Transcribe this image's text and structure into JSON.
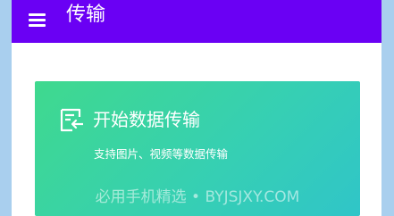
{
  "header": {
    "title": "传输",
    "menu_icon": "menu-icon",
    "color": "#6a00f4"
  },
  "card": {
    "icon": "transfer-document-icon",
    "title": "开始数据传输",
    "subtitle": "支持图片、视频等数据传输",
    "gradient_start": "#3fd98e",
    "gradient_end": "#30c5c8"
  },
  "watermark": {
    "text": "必用手机精选 • BYJSJXY.COM"
  }
}
